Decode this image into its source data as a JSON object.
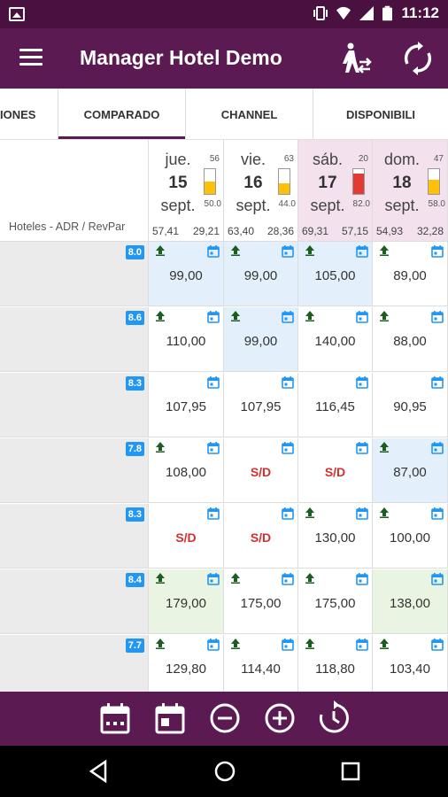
{
  "status_bar": {
    "time": "11:12",
    "icons": [
      "image-icon",
      "vibrate-icon",
      "wifi-icon",
      "signal-icon",
      "battery-icon"
    ]
  },
  "toolbar": {
    "title": "Manager Hotel Demo",
    "icons": [
      "menu-icon",
      "walk-icon",
      "sync-icon"
    ]
  },
  "tabs": [
    {
      "label": "IONES"
    },
    {
      "label": "COMPARADO",
      "active": true
    },
    {
      "label": "CHANNEL"
    },
    {
      "label": "DISPONIBILI"
    }
  ],
  "table": {
    "corner_label": "Hoteles - ADR / RevPar",
    "days": [
      {
        "name": "jue.",
        "num": "15",
        "month": "sept.",
        "capacity": "56",
        "occupancy": "50.0",
        "occ_fraction": 0.5,
        "bar_color": "#ffc107",
        "adr": "57,41",
        "revpar": "29,21",
        "weekend": false
      },
      {
        "name": "vie.",
        "num": "16",
        "month": "sept.",
        "capacity": "63",
        "occupancy": "44.0",
        "occ_fraction": 0.44,
        "bar_color": "#ffc107",
        "adr": "63,40",
        "revpar": "28,36",
        "weekend": false
      },
      {
        "name": "sáb.",
        "num": "17",
        "month": "sept.",
        "capacity": "20",
        "occupancy": "82.0",
        "occ_fraction": 0.82,
        "bar_color": "#e53935",
        "adr": "69,31",
        "revpar": "57,15",
        "weekend": true
      },
      {
        "name": "dom.",
        "num": "18",
        "month": "sept.",
        "capacity": "47",
        "occupancy": "58.0",
        "occ_fraction": 0.58,
        "bar_color": "#ffc107",
        "adr": "54,93",
        "revpar": "32,28",
        "weekend": true
      }
    ],
    "rows": [
      {
        "score": "8.0",
        "cells": [
          {
            "price": "99,00",
            "up": true,
            "bg": "blue"
          },
          {
            "price": "99,00",
            "up": true,
            "bg": "blue"
          },
          {
            "price": "105,00",
            "up": true,
            "bg": "blue"
          },
          {
            "price": "89,00",
            "up": true,
            "bg": ""
          }
        ]
      },
      {
        "score": "8.6",
        "cells": [
          {
            "price": "110,00",
            "up": true,
            "bg": ""
          },
          {
            "price": "99,00",
            "up": true,
            "bg": "blue"
          },
          {
            "price": "140,00",
            "up": true,
            "bg": ""
          },
          {
            "price": "88,00",
            "up": true,
            "bg": ""
          }
        ]
      },
      {
        "score": "8.3",
        "cells": [
          {
            "price": "107,95",
            "up": false,
            "bg": ""
          },
          {
            "price": "107,95",
            "up": false,
            "bg": ""
          },
          {
            "price": "116,45",
            "up": false,
            "bg": ""
          },
          {
            "price": "90,95",
            "up": false,
            "bg": ""
          }
        ]
      },
      {
        "score": "7.8",
        "cells": [
          {
            "price": "108,00",
            "up": true,
            "bg": ""
          },
          {
            "price": "S/D",
            "up": false,
            "bg": "",
            "na": true
          },
          {
            "price": "S/D",
            "up": false,
            "bg": "",
            "na": true
          },
          {
            "price": "87,00",
            "up": true,
            "bg": "blue"
          }
        ]
      },
      {
        "score": "8.3",
        "cells": [
          {
            "price": "S/D",
            "up": false,
            "bg": "",
            "na": true
          },
          {
            "price": "S/D",
            "up": false,
            "bg": "",
            "na": true
          },
          {
            "price": "130,00",
            "up": true,
            "bg": ""
          },
          {
            "price": "100,00",
            "up": true,
            "bg": ""
          }
        ]
      },
      {
        "score": "8.4",
        "cells": [
          {
            "price": "179,00",
            "up": true,
            "bg": "green"
          },
          {
            "price": "175,00",
            "up": true,
            "bg": ""
          },
          {
            "price": "175,00",
            "up": true,
            "bg": ""
          },
          {
            "price": "138,00",
            "up": false,
            "bg": "green"
          }
        ]
      },
      {
        "score": "7.7",
        "cells": [
          {
            "price": "129,80",
            "up": true,
            "bg": ""
          },
          {
            "price": "114,40",
            "up": true,
            "bg": ""
          },
          {
            "price": "118,80",
            "up": true,
            "bg": ""
          },
          {
            "price": "103,40",
            "up": true,
            "bg": ""
          }
        ]
      }
    ]
  },
  "bottom_bar": {
    "icons": [
      "calendar-week-icon",
      "calendar-day-icon",
      "zoom-out-icon",
      "zoom-in-icon",
      "history-icon"
    ]
  },
  "nav_bar": {
    "icons": [
      "back-icon",
      "home-icon",
      "recents-icon"
    ]
  },
  "colors": {
    "primary": "#5c1a52",
    "status_bar": "#4a1040",
    "score_badge": "#2196f3",
    "unavailable": "#d32f2f",
    "highlight_blue": "#e3f0fb",
    "highlight_green": "#eaf4e2",
    "weekend": "#f3e2ee"
  }
}
